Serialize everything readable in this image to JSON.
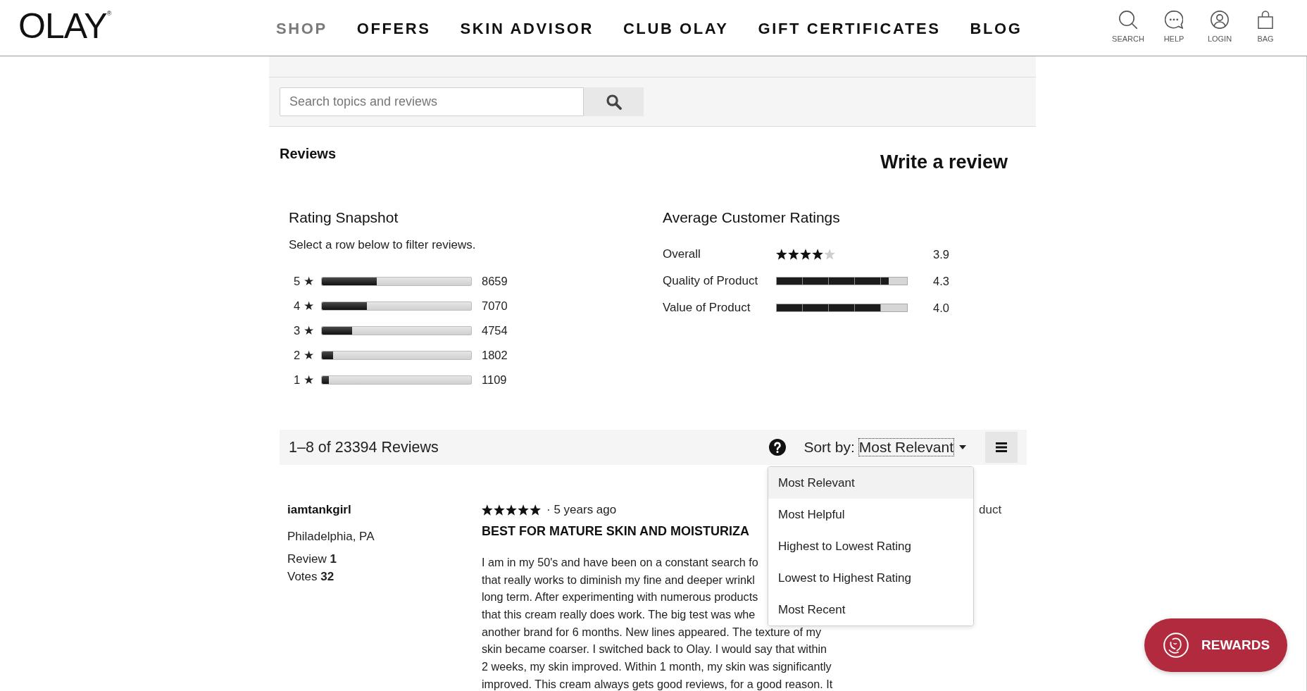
{
  "header": {
    "logo": "OLAY$^{®}$",
    "nav": [
      {
        "label": "SHOP",
        "selected": true
      },
      {
        "label": "OFFERS",
        "selected": false
      },
      {
        "label": "SKIN ADVISOR",
        "selected": false
      },
      {
        "label": "CLUB OLAY",
        "selected": false
      },
      {
        "label": "GIFT CERTIFICATES",
        "selected": false
      },
      {
        "label": "BLOG",
        "selected": false
      }
    ],
    "icons": [
      {
        "kind": "search",
        "label": "SEARCH"
      },
      {
        "kind": "help",
        "label": "HELP"
      },
      {
        "kind": "login",
        "label": "LOGIN"
      },
      {
        "kind": "bag",
        "label": "BAG"
      }
    ]
  },
  "search": {
    "placeholder": "Search topics and reviews"
  },
  "reviews": {
    "heading": "Reviews",
    "write_review": "Write a review"
  },
  "rating_snapshot": {
    "title": "Rating Snapshot",
    "hint": "Select a row below to filter reviews.",
    "rows": [
      {
        "label": "5 ★",
        "level": 0.37,
        "count": "8659"
      },
      {
        "label": "4 ★",
        "level": 0.302,
        "count": "7070"
      },
      {
        "label": "3 ★",
        "level": 0.203,
        "count": "4754"
      },
      {
        "label": "2 ★",
        "level": 0.077,
        "count": "1802"
      },
      {
        "label": "1 ★",
        "level": 0.047,
        "count": "1109"
      }
    ]
  },
  "average_ratings": {
    "title": "Average Customer Ratings",
    "rows": [
      {
        "kind": "stars",
        "label": "Overall",
        "stars": 4,
        "score": "3.9"
      },
      {
        "kind": "bar",
        "label": "Quality of Product",
        "level": 0.86,
        "score": "4.3"
      },
      {
        "kind": "bar",
        "label": "Value of Product",
        "level": 0.8,
        "score": "4.0"
      }
    ]
  },
  "sort_bar": {
    "count": "1–8 of 23394 Reviews",
    "sort_label": "Sort by:",
    "sort_value": "Most Relevant",
    "expanded": true,
    "options": [
      {
        "label": "Most Relevant",
        "selected": true
      },
      {
        "label": "Most Helpful",
        "selected": false
      },
      {
        "label": "Highest to Lowest Rating",
        "selected": false
      },
      {
        "label": "Lowest to Highest Rating",
        "selected": false
      },
      {
        "label": "Most Recent",
        "selected": false
      }
    ]
  },
  "review": {
    "author": "iamtankgirl",
    "location": "Philadelphia, PA",
    "stats": [
      "Review **1**",
      "Votes **32**"
    ],
    "stars": 5,
    "age": "· 5 years ago",
    "title": "BEST FOR MATURE SKIN AND MOISTURIZA",
    "body_lines": [
      "I am in my 50's and have been on a constant search fo",
      "that really works to diminish my fine and deeper wrinkl",
      "long term. After experimenting with numerous products",
      "that this cream really does work. The big test was whe",
      "another brand for 6 months. New lines appeared. The texture of my",
      "skin became coarser. I switched back to Olay. I would say that within",
      "2 weeks, my skin improved. Within 1 month, my skin was significantly",
      "improved. This cream always gets good reviews, for a good reason. It"
    ],
    "side_text": "duct"
  },
  "rewards_button": {
    "label": "REWARDS"
  }
}
